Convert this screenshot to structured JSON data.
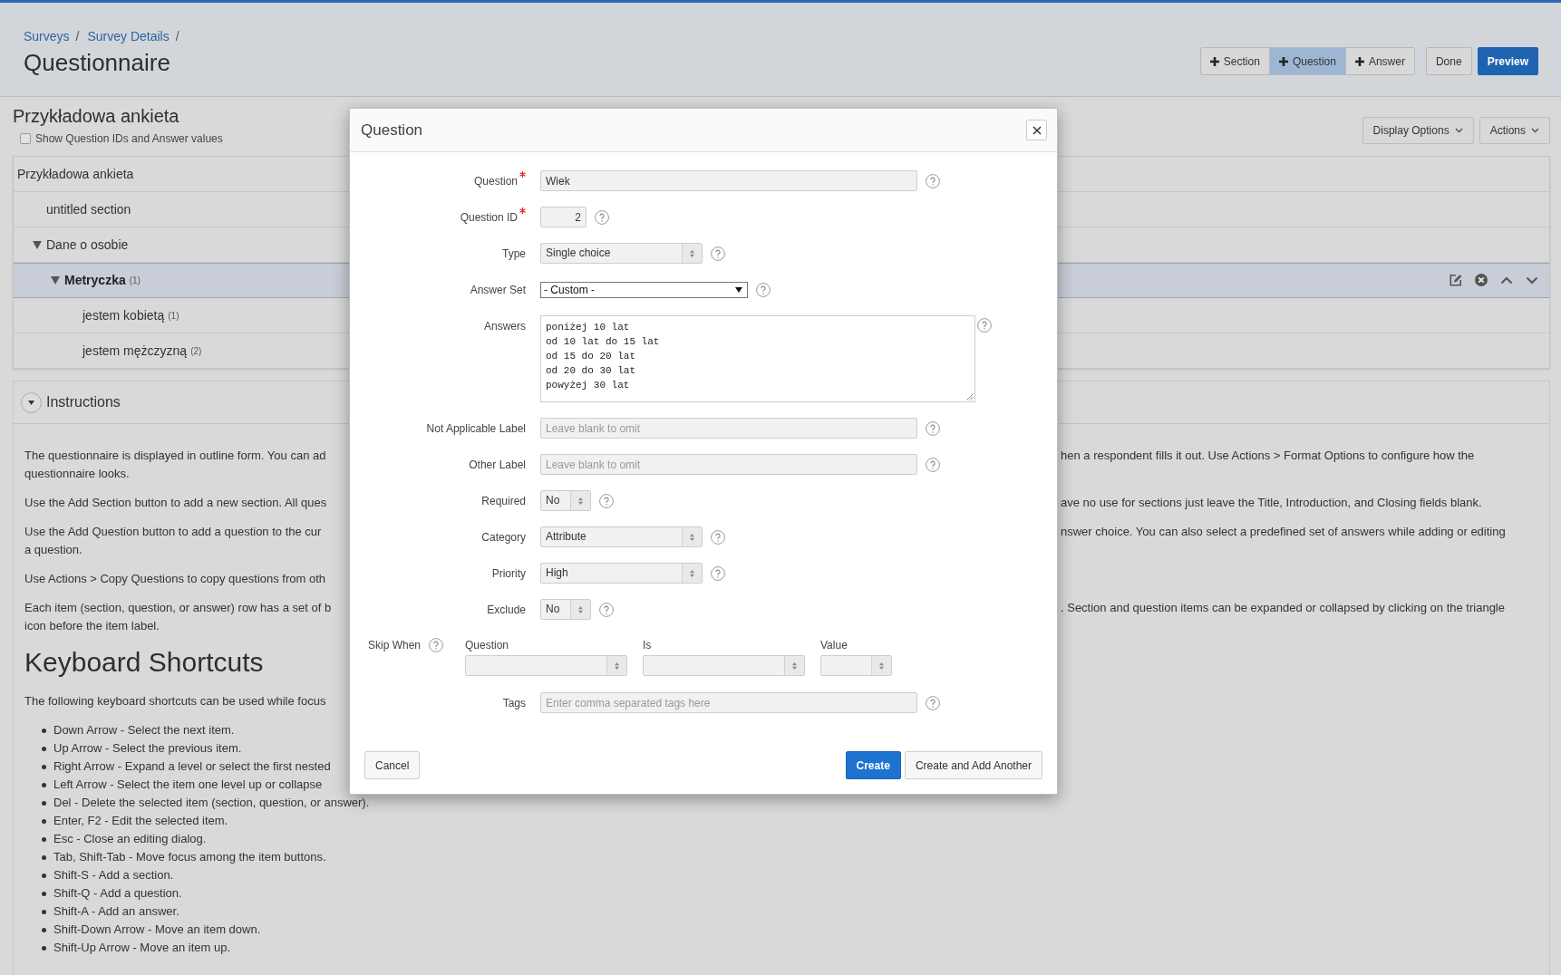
{
  "breadcrumb": {
    "items": [
      "Surveys",
      "Survey Details"
    ],
    "separator": "/"
  },
  "page_title": "Questionnaire",
  "toolbar": {
    "add_buttons": [
      {
        "label": "Section",
        "selected": false
      },
      {
        "label": "Question",
        "selected": true
      },
      {
        "label": "Answer",
        "selected": false
      }
    ],
    "buttons": [
      {
        "label": "Done",
        "kind": "default"
      },
      {
        "label": "Preview",
        "kind": "primary"
      }
    ]
  },
  "survey": {
    "title": "Przykładowa ankieta",
    "show_ids": {
      "label": "Show Question IDs and Answer values",
      "checked": false
    },
    "menus": [
      "Display Options",
      "Actions"
    ]
  },
  "tree": {
    "items": [
      {
        "label": "Przykładowa ankieta",
        "selected": false,
        "children": [
          {
            "label": "untitled section",
            "selected": false
          },
          {
            "label": "Dane o osobie",
            "selected": false,
            "expanded": true,
            "children": [
              {
                "label": "Metryczka",
                "count": "(1)",
                "selected": true,
                "expanded": true,
                "children": [
                  {
                    "label": "jestem kobietą",
                    "count": "(1)",
                    "selected": false
                  },
                  {
                    "label": "jestem mężczyzną",
                    "count": "(2)",
                    "selected": false
                  }
                ]
              }
            ]
          }
        ]
      }
    ]
  },
  "instructions": {
    "title": "Instructions",
    "expanded": true,
    "paragraphs": [
      {
        "lines": [
          {
            "left": "The questionnaire is displayed in outline form. You can ad",
            "right": "hen a respondent fills it out. Use Actions > Format Options to configure how the"
          },
          {
            "left": "questionnaire looks."
          }
        ]
      },
      {
        "lines": [
          {
            "left": "Use the Add Section button to add a new section. All ques",
            "right": "ave no use for sections just leave the Title, Introduction, and Closing fields blank."
          }
        ]
      },
      {
        "lines": [
          {
            "left": "Use the Add Question button to add a question to the cur",
            "right": "nswer choice. You can also select a predefined set of answers while adding or editing"
          },
          {
            "left": "a question."
          }
        ]
      },
      {
        "lines": [
          {
            "left": "Use Actions > Copy Questions to copy questions from oth"
          }
        ]
      },
      {
        "lines": [
          {
            "left": "Each item (section, question, or answer) row has a set of b",
            "right": ". Section and question items can be expanded or collapsed by clicking on the triangle"
          },
          {
            "left": "icon before the item label."
          }
        ]
      }
    ],
    "heading": "Keyboard Shortcuts",
    "intro": "The following keyboard shortcuts can be used while focus",
    "shortcuts": [
      "Down Arrow - Select the next item.",
      "Up Arrow - Select the previous item.",
      "Right Arrow - Expand a level or select the first nested",
      "Left Arrow - Select the item one level up or collapse",
      "Del - Delete the selected item (section, question, or answer).",
      "Enter, F2 - Edit the selected item.",
      "Esc - Close an editing dialog.",
      "Tab, Shift-Tab - Move focus among the item buttons.",
      "Shift-S - Add a section.",
      "Shift-Q - Add a question.",
      "Shift-A - Add an answer.",
      "Shift-Down Arrow - Move an item down.",
      "Shift-Up Arrow - Move an item up."
    ]
  },
  "dialog": {
    "title": "Question",
    "fields": [
      {
        "kind": "text",
        "label": "Question",
        "required": true,
        "value": "Wiek"
      },
      {
        "kind": "number",
        "label": "Question ID",
        "required": true,
        "value": "2"
      },
      {
        "kind": "select",
        "label": "Type",
        "required": false,
        "value": "Single choice"
      },
      {
        "kind": "dropdown",
        "label": "Answer Set",
        "required": false,
        "value": "- Custom -"
      },
      {
        "kind": "textarea",
        "label": "Answers",
        "required": false,
        "lines": [
          "poniżej 10 lat",
          "od 10 lat do 15 lat",
          "od 15 do 20 lat",
          "od 20 do 30 lat",
          "powyżej 30 lat"
        ]
      },
      {
        "kind": "text",
        "label": "Not Applicable Label",
        "required": false,
        "placeholder": "Leave blank to omit"
      },
      {
        "kind": "text",
        "label": "Other Label",
        "required": false,
        "placeholder": "Leave blank to omit"
      },
      {
        "kind": "yes-no",
        "label": "Required",
        "required": false,
        "value": "No"
      },
      {
        "kind": "select",
        "label": "Category",
        "required": false,
        "value": "Attribute"
      },
      {
        "kind": "select",
        "label": "Priority",
        "required": false,
        "value": "High"
      },
      {
        "kind": "yes-no",
        "label": "Exclude",
        "required": false,
        "value": "No"
      },
      {
        "kind": "skip",
        "label": "Skip When",
        "required": false,
        "columns": [
          {
            "label": "Question",
            "kind": "wide"
          },
          {
            "label": "Is",
            "kind": "wide"
          },
          {
            "label": "Value",
            "kind": "narrow"
          }
        ]
      },
      {
        "kind": "text",
        "label": "Tags",
        "required": false,
        "placeholder": "Enter comma separated tags here"
      }
    ],
    "buttons": [
      {
        "label": "Cancel",
        "kind": "cancel"
      },
      {
        "label": "Create",
        "kind": "primary"
      },
      {
        "label": "Create and Add Another",
        "kind": "secondary"
      }
    ]
  }
}
